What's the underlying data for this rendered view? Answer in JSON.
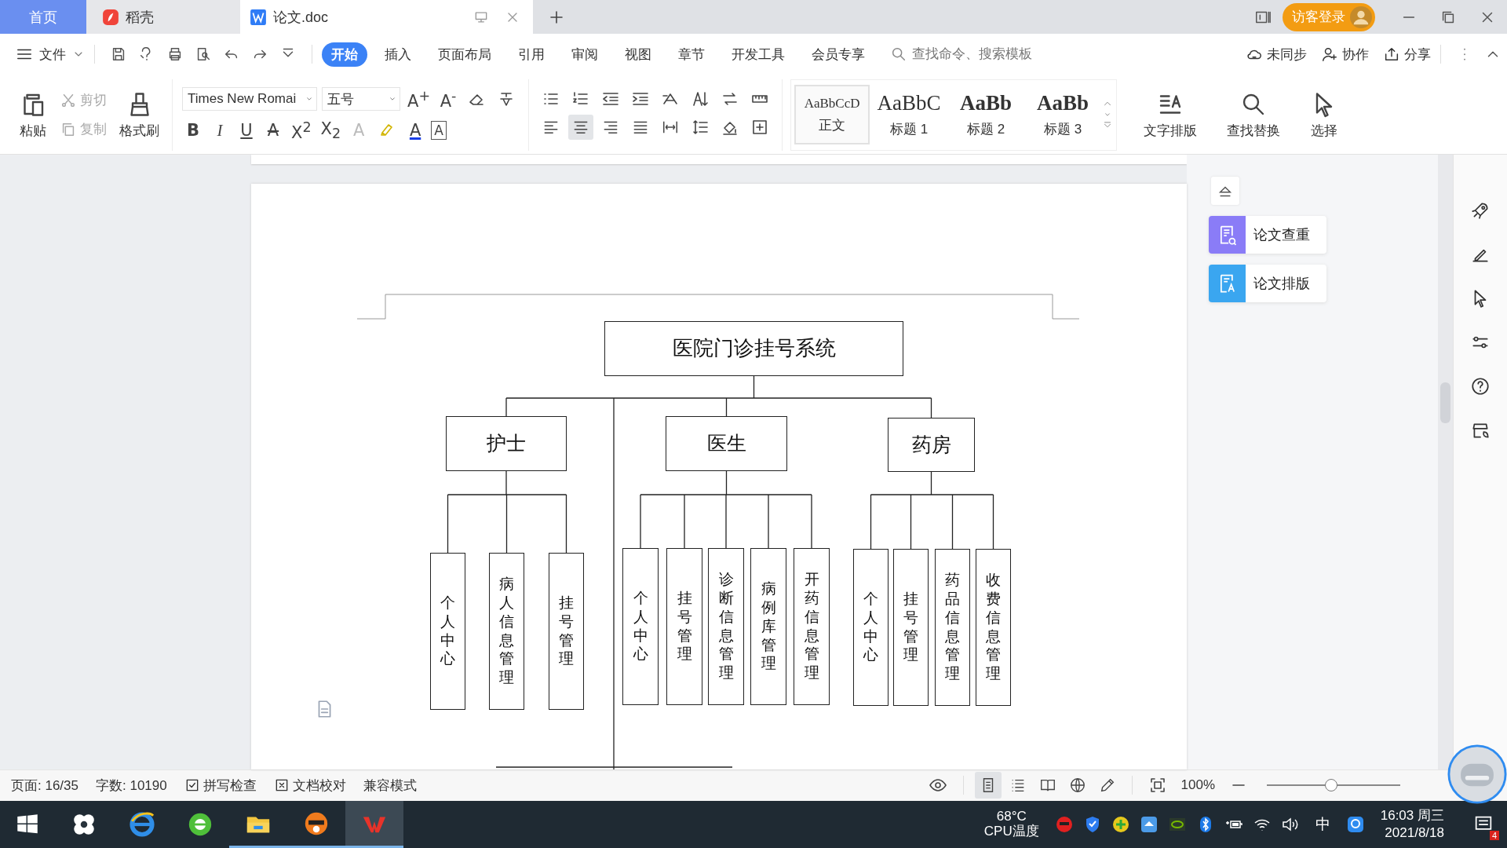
{
  "tabs": [
    {
      "kind": "home",
      "label": "首页",
      "selected": false
    },
    {
      "kind": "docer",
      "label": "稻壳",
      "selected": false
    },
    {
      "kind": "document",
      "label": "论文.doc",
      "selected": true
    }
  ],
  "login_button": "访客登录",
  "file_menu": "文件",
  "ribbon_tabs": [
    {
      "label": "开始",
      "selected": true
    },
    {
      "label": "插入",
      "selected": false
    },
    {
      "label": "页面布局",
      "selected": false
    },
    {
      "label": "引用",
      "selected": false
    },
    {
      "label": "审阅",
      "selected": false
    },
    {
      "label": "视图",
      "selected": false
    },
    {
      "label": "章节",
      "selected": false
    },
    {
      "label": "开发工具",
      "selected": false
    },
    {
      "label": "会员专享",
      "selected": false
    }
  ],
  "search": {
    "placeholder": "查找命令、搜索模板"
  },
  "actions": [
    "未同步",
    "协作",
    "分享"
  ],
  "clipboard": {
    "paste": "粘贴",
    "cut": {
      "label": "剪切",
      "disabled": true
    },
    "copy": {
      "label": "复制",
      "disabled": true
    },
    "format_painter": "格式刷"
  },
  "font": {
    "name": "Times New Romai",
    "size": "五号"
  },
  "size_buttons": [
    {
      "label": "A$^{+}$"
    },
    {
      "label": "A$^{-}$"
    }
  ],
  "format_buttons": [
    {
      "kind": "bold",
      "label": "B"
    },
    {
      "kind": "italic",
      "label": "I"
    },
    {
      "kind": "underline",
      "label": "U"
    },
    {
      "kind": "strike",
      "label": "A"
    },
    {
      "kind": "plain",
      "label": "X$^{2}$"
    },
    {
      "kind": "plain",
      "label": "X$_{2}$"
    },
    {
      "kind": "effect",
      "label": "A"
    },
    {
      "kind": "highlight"
    },
    {
      "kind": "color",
      "label": "A"
    },
    {
      "kind": "border",
      "label": "A"
    }
  ],
  "alignment": [
    {
      "selected": false
    },
    {
      "selected": true
    },
    {
      "selected": false
    },
    {
      "selected": false
    },
    {
      "selected": false
    }
  ],
  "styles": [
    {
      "kind": "normal",
      "preview": "AaBbCcD",
      "label": "正文",
      "selected": true
    },
    {
      "kind": "h1",
      "preview": "AaBbC",
      "label": "标题 1",
      "selected": false
    },
    {
      "kind": "h2",
      "preview": "AaBb",
      "label": "标题 2",
      "selected": false
    },
    {
      "kind": "h3",
      "preview": "AaBb",
      "label": "标题 3",
      "selected": false
    }
  ],
  "tools": [
    "文字排版",
    "查找替换",
    "选择"
  ],
  "side_tools": [
    {
      "label": "论文查重",
      "color": "#8a7cf7"
    },
    {
      "label": "论文排版",
      "color": "#3aa6f0"
    }
  ],
  "diagram": {
    "root": "医院门诊挂号系统",
    "branches": [
      {
        "label": "护士",
        "children": [
          "个人中心",
          "病人信息管理",
          "挂号管理"
        ]
      },
      {
        "label": "医生",
        "children": [
          "个人中心",
          "挂号管理",
          "诊断信息管理",
          "病例库管理",
          "开药信息管理"
        ]
      },
      {
        "label": "药房",
        "children": [
          "个人中心",
          "挂号管理",
          "药品信息管理",
          "收费信息管理"
        ]
      }
    ]
  },
  "status": {
    "page": "页面: 16/35",
    "words": "字数: 10190",
    "spell_check": "拼写检查",
    "proofread": "文档校对",
    "mode": "兼容模式",
    "zoom": "100%",
    "zoom_slider": {
      "level": 0.48
    }
  },
  "view_modes": [
    {
      "selected": true
    },
    {
      "selected": false
    },
    {
      "selected": false
    },
    {
      "selected": false
    },
    {
      "selected": false
    }
  ],
  "taskbar_apps": [
    {
      "running": false,
      "selected": false
    },
    {
      "running": false,
      "selected": false
    },
    {
      "running": false,
      "selected": false
    },
    {
      "running": true,
      "selected": false
    },
    {
      "running": true,
      "selected": false
    },
    {
      "running": true,
      "selected": true
    }
  ],
  "taskbar": {
    "cpu_temp": "68°C",
    "cpu_label": "CPU温度",
    "ime": "中",
    "time": "16:03 周三",
    "date": "2021/8/18",
    "notifications": "4"
  }
}
